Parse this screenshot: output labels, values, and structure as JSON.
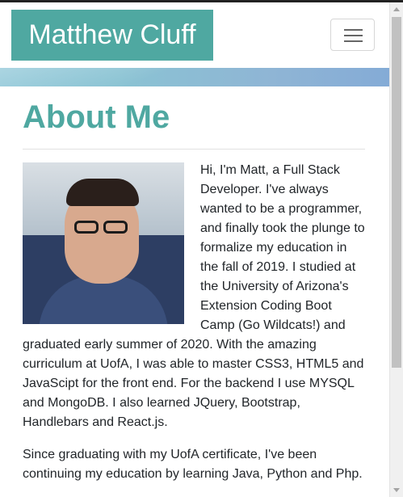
{
  "navbar": {
    "brand": "Matthew Cluff",
    "toggler_icon": "hamburger-menu-icon",
    "brand_color": "#4fa8a1"
  },
  "main": {
    "title": "About Me",
    "photo_alt": "Photo of Matthew Cluff",
    "paragraphs": [
      "Hi, I'm Matt, a Full Stack Developer. I've always wanted to be a programmer, and finally took the plunge to formalize my education in the fall of 2019. I studied at the University of Arizona's Extension Coding Boot Camp (Go Wildcats!) and graduated early summer of 2020. With the amazing curriculum at UofA, I was able to master CSS3, HTML5 and JavaScipt for the front end. For the backend I use MYSQL and MongoDB. I also learned JQuery, Bootstrap, Handlebars and React.js.",
      "Since graduating with my UofA certificate, I've been continuing my education by learning Java, Python and Php."
    ]
  }
}
